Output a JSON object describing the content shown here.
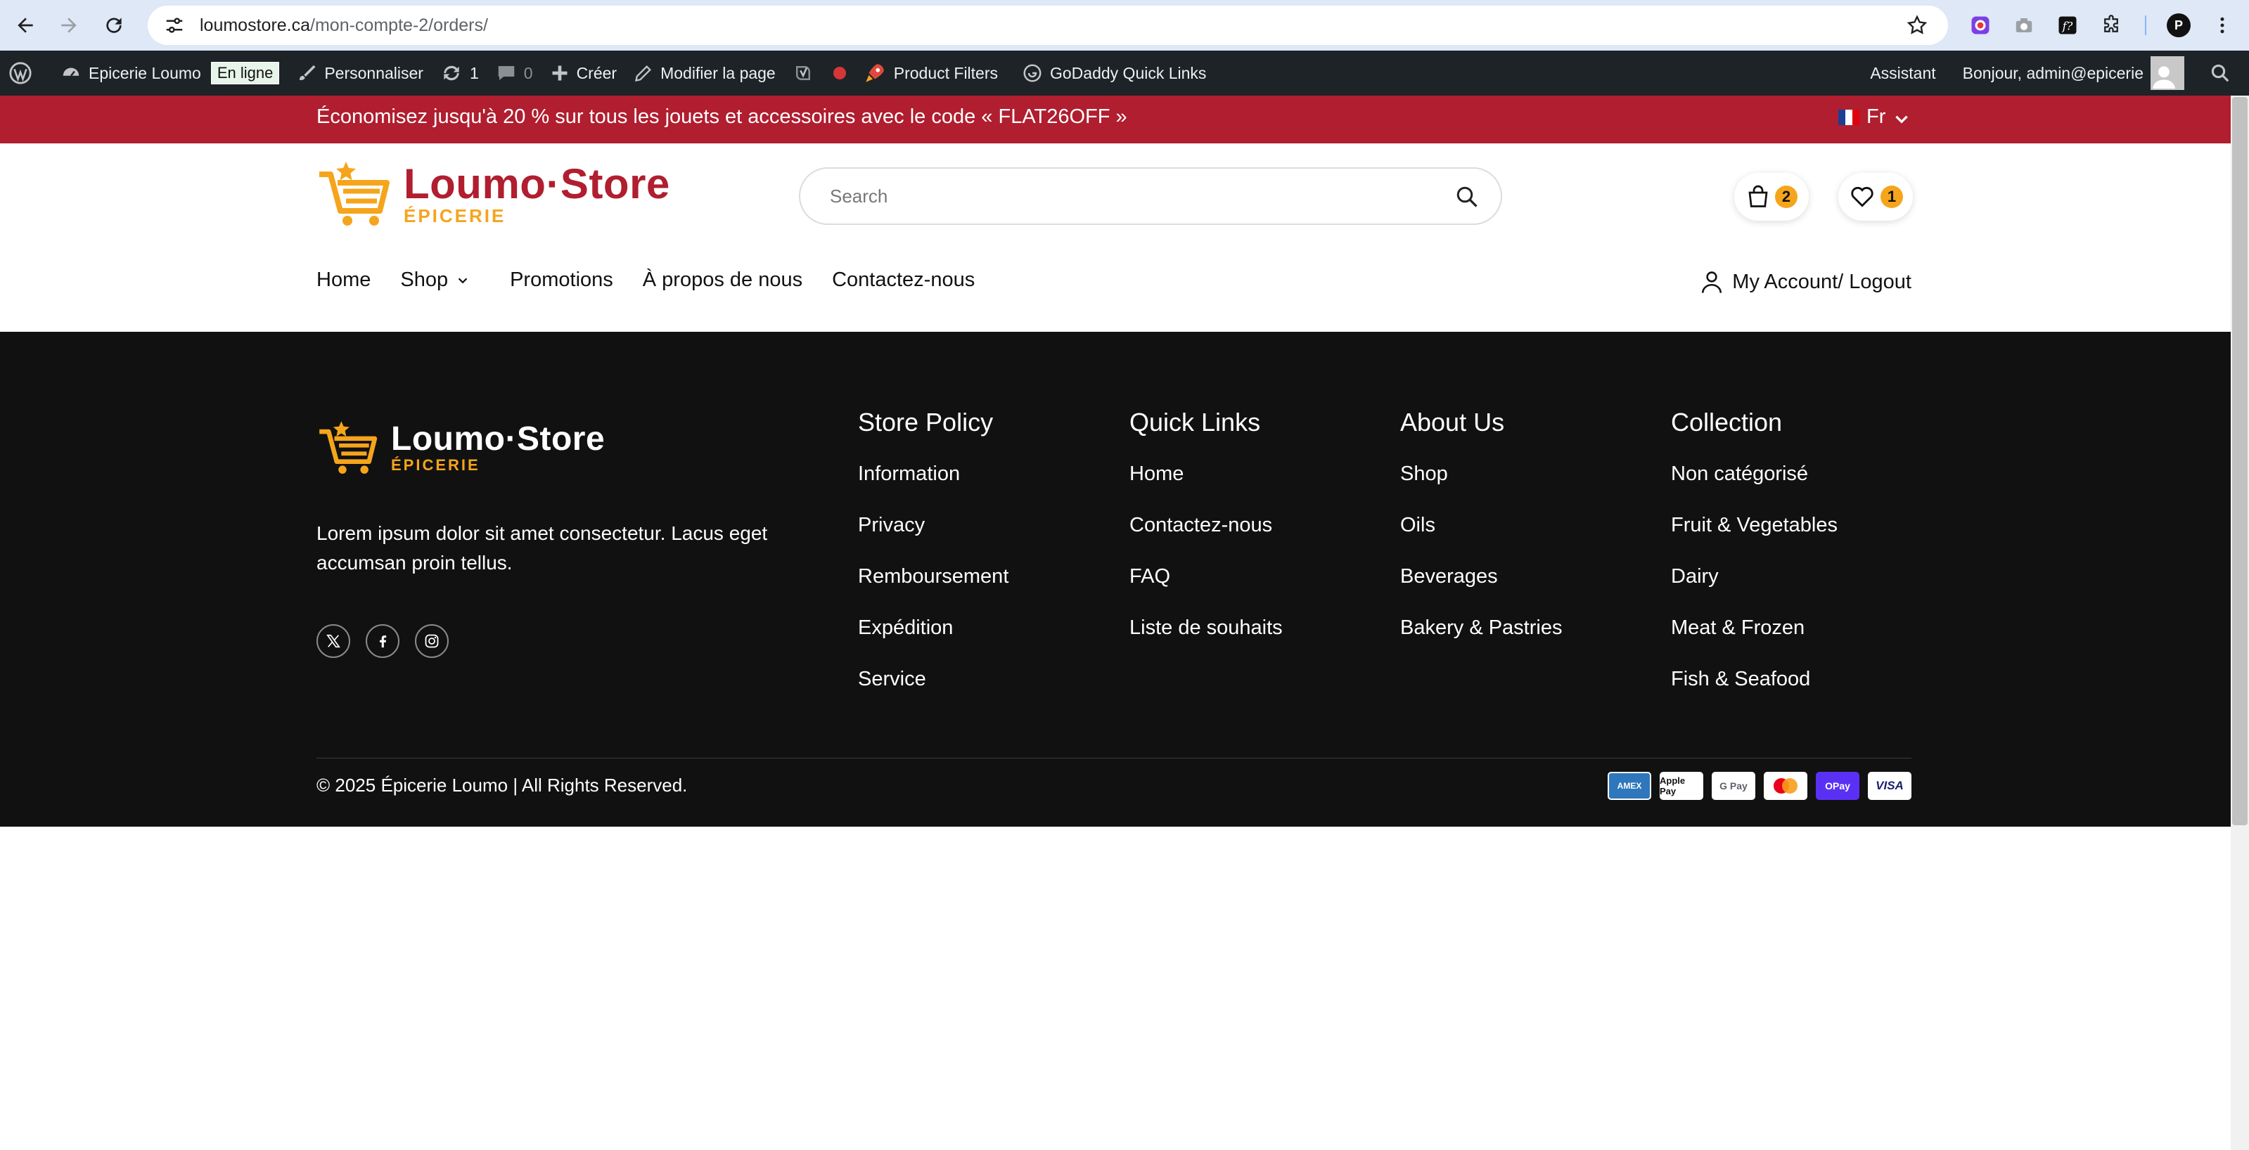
{
  "browser": {
    "url_host": "loumostore.ca",
    "url_path": "/mon-compte-2/orders/",
    "profile_letter": "P"
  },
  "adminbar": {
    "site_name": "Epicerie Loumo",
    "status_badge": "En ligne",
    "customize": "Personnaliser",
    "updates_count": "1",
    "comments_count": "0",
    "create": "Créer",
    "edit_page": "Modifier la page",
    "product_filters": "Product Filters",
    "godaddy": "GoDaddy Quick Links",
    "assistant": "Assistant",
    "greeting": "Bonjour, admin@epicerie"
  },
  "promo": {
    "text": "Économisez jusqu'à 20 % sur tous les jouets et accessoires avec le code « FLAT26OFF »",
    "language": "Fr"
  },
  "header": {
    "logo_name": "Loumo·Store",
    "logo_sub": "ÉPICERIE",
    "search_placeholder": "Search",
    "cart_count": "2",
    "wishlist_count": "1",
    "nav": [
      "Home",
      "Shop",
      "Promotions",
      "À propos de nous",
      "Contactez-nous"
    ],
    "account": "My Account/ Logout"
  },
  "footer": {
    "logo_name": "Loumo·Store",
    "logo_sub": "ÉPICERIE",
    "description": "Lorem ipsum dolor sit amet consectetur. Lacus eget accumsan proin tellus.",
    "columns": [
      {
        "title": "Store Policy",
        "links": [
          "Information",
          "Privacy",
          "Remboursement",
          "Expédition",
          "Service"
        ]
      },
      {
        "title": "Quick Links",
        "links": [
          "Home",
          "Contactez-nous",
          "FAQ",
          "Liste de souhaits"
        ]
      },
      {
        "title": "About Us",
        "links": [
          "Shop",
          "Oils",
          "Beverages",
          "Bakery & Pastries"
        ]
      },
      {
        "title": "Collection",
        "links": [
          "Non catégorisé",
          "Fruit & Vegetables",
          "Dairy",
          "Meat & Frozen",
          "Fish & Seafood"
        ]
      }
    ],
    "copyright": "© 2025 Épicerie Loumo | All Rights Reserved.",
    "payments": [
      "AMEX",
      "Apple Pay",
      "G Pay",
      "Mastercard",
      "OPay",
      "VISA"
    ]
  },
  "colors": {
    "brand_red": "#b01e2f",
    "brand_orange": "#f5a51c",
    "footer_bg": "#111111",
    "admin_bar": "#1d2327"
  }
}
